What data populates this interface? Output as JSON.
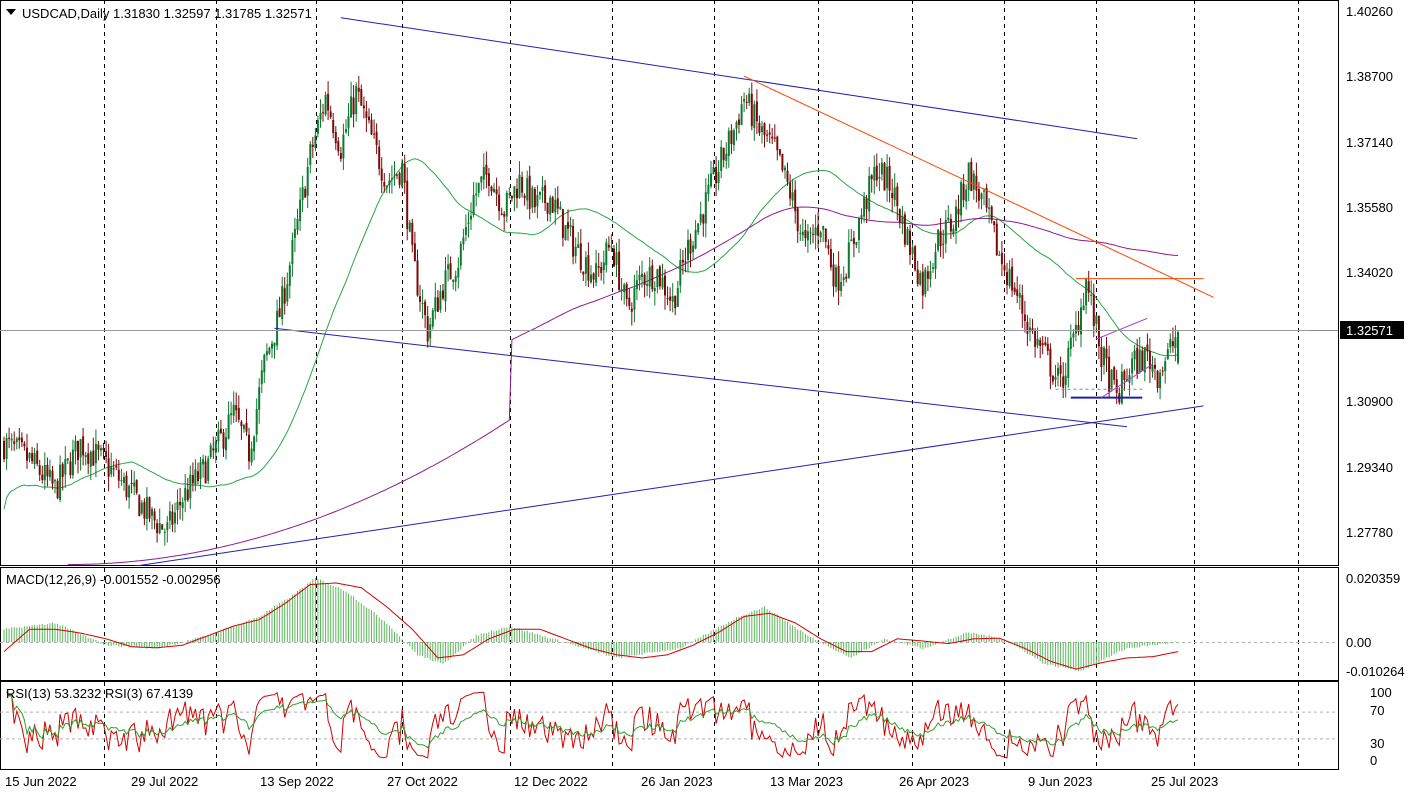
{
  "symbol_header": "USDCAD,Daily  1.31830 1.32597 1.31785 1.32571",
  "current_price_label": "1.32571",
  "colors": {
    "bull": "#0b7a2e",
    "bear": "#7a0a0a",
    "ma_fast": "#28a745",
    "ma_slow": "#8e1b8e",
    "trend_blue": "#1f1fb5",
    "trend_red": "#ff4500",
    "macd_hist": "#5cb85c",
    "macd_signal": "#d40000",
    "rsi13": "#2ca02c",
    "rsi3": "#d40000"
  },
  "chart_data": [
    {
      "type": "candlestick",
      "title": "USDCAD,Daily",
      "ohlc_last": {
        "open": 1.3183,
        "high": 1.32597,
        "low": 1.31785,
        "close": 1.32571
      },
      "y_ticks": [
        "1.40260",
        "1.38700",
        "1.37140",
        "1.35580",
        "1.34020",
        "1.32571",
        "1.30900",
        "1.29340",
        "1.27780"
      ],
      "ylim": [
        1.266,
        1.405
      ],
      "x_ticks": [
        "15 Jun 2022",
        "29 Jul 2022",
        "13 Sep 2022",
        "27 Oct 2022",
        "12 Dec 2022",
        "26 Jan 2023",
        "13 Mar 2023",
        "26 Apr 2023",
        "9 Jun 2023",
        "25 Jul 2023"
      ],
      "grid": true,
      "price_path": [
        [
          0,
          1.299
        ],
        [
          10,
          1.295
        ],
        [
          20,
          1.288
        ],
        [
          30,
          1.299
        ],
        [
          40,
          1.294
        ],
        [
          50,
          1.287
        ],
        [
          58,
          1.281
        ],
        [
          64,
          1.278
        ],
        [
          70,
          1.286
        ],
        [
          80,
          1.294
        ],
        [
          90,
          1.306
        ],
        [
          96,
          1.297
        ],
        [
          102,
          1.318
        ],
        [
          108,
          1.33
        ],
        [
          114,
          1.348
        ],
        [
          120,
          1.368
        ],
        [
          126,
          1.382
        ],
        [
          132,
          1.37
        ],
        [
          138,
          1.383
        ],
        [
          144,
          1.372
        ],
        [
          150,
          1.362
        ],
        [
          156,
          1.365
        ],
        [
          160,
          1.343
        ],
        [
          166,
          1.326
        ],
        [
          172,
          1.337
        ],
        [
          178,
          1.343
        ],
        [
          184,
          1.358
        ],
        [
          190,
          1.364
        ],
        [
          196,
          1.355
        ],
        [
          202,
          1.362
        ],
        [
          208,
          1.356
        ],
        [
          214,
          1.358
        ],
        [
          220,
          1.35
        ],
        [
          226,
          1.344
        ],
        [
          232,
          1.339
        ],
        [
          238,
          1.347
        ],
        [
          244,
          1.331
        ],
        [
          250,
          1.339
        ],
        [
          256,
          1.34
        ],
        [
          262,
          1.333
        ],
        [
          268,
          1.346
        ],
        [
          274,
          1.355
        ],
        [
          280,
          1.365
        ],
        [
          286,
          1.374
        ],
        [
          290,
          1.382
        ],
        [
          296,
          1.374
        ],
        [
          302,
          1.369
        ],
        [
          308,
          1.359
        ],
        [
          314,
          1.346
        ],
        [
          320,
          1.352
        ],
        [
          326,
          1.338
        ],
        [
          330,
          1.342
        ],
        [
          336,
          1.354
        ],
        [
          342,
          1.365
        ],
        [
          348,
          1.36
        ],
        [
          354,
          1.348
        ],
        [
          360,
          1.337
        ],
        [
          366,
          1.348
        ],
        [
          372,
          1.352
        ],
        [
          378,
          1.364
        ],
        [
          384,
          1.356
        ],
        [
          390,
          1.344
        ],
        [
          396,
          1.336
        ],
        [
          402,
          1.326
        ],
        [
          408,
          1.32
        ],
        [
          414,
          1.313
        ],
        [
          420,
          1.326
        ],
        [
          424,
          1.338
        ],
        [
          430,
          1.32
        ],
        [
          436,
          1.31
        ],
        [
          442,
          1.318
        ],
        [
          448,
          1.32
        ],
        [
          452,
          1.316
        ],
        [
          456,
          1.32
        ],
        [
          460,
          1.3257
        ]
      ]
    },
    {
      "type": "line",
      "title": "MACD(12,26,9) -0.001552 -0.002956",
      "y_ticks": [
        "0.020359",
        "0.00",
        "-0.010264"
      ],
      "ylim": [
        -0.0125,
        0.0225
      ],
      "signal_path": [
        [
          0,
          -0.003
        ],
        [
          10,
          0.004
        ],
        [
          20,
          0.004
        ],
        [
          30,
          0.0028
        ],
        [
          40,
          0.001
        ],
        [
          50,
          -0.0015
        ],
        [
          60,
          -0.0018
        ],
        [
          70,
          -0.001
        ],
        [
          80,
          0.002
        ],
        [
          90,
          0.005
        ],
        [
          100,
          0.007
        ],
        [
          110,
          0.012
        ],
        [
          120,
          0.018
        ],
        [
          130,
          0.0185
        ],
        [
          140,
          0.017
        ],
        [
          150,
          0.011
        ],
        [
          160,
          0.004
        ],
        [
          170,
          -0.005
        ],
        [
          180,
          -0.004
        ],
        [
          190,
          0.001
        ],
        [
          200,
          0.004
        ],
        [
          210,
          0.004
        ],
        [
          220,
          0.001
        ],
        [
          230,
          -0.002
        ],
        [
          240,
          -0.004
        ],
        [
          250,
          -0.005
        ],
        [
          260,
          -0.004
        ],
        [
          270,
          -0.001
        ],
        [
          280,
          0.003
        ],
        [
          290,
          0.008
        ],
        [
          300,
          0.009
        ],
        [
          310,
          0.006
        ],
        [
          320,
          0.001
        ],
        [
          330,
          -0.003
        ],
        [
          340,
          -0.003
        ],
        [
          350,
          0.001
        ],
        [
          360,
          0.0003
        ],
        [
          370,
          -0.0005
        ],
        [
          380,
          0.001
        ],
        [
          390,
          0.0012
        ],
        [
          400,
          -0.002
        ],
        [
          410,
          -0.006
        ],
        [
          420,
          -0.0085
        ],
        [
          430,
          -0.0065
        ],
        [
          440,
          -0.005
        ],
        [
          450,
          -0.0046
        ],
        [
          460,
          -0.003
        ]
      ],
      "hist_path": [
        [
          0,
          0.004
        ],
        [
          20,
          0.006
        ],
        [
          40,
          -0.001
        ],
        [
          60,
          -0.002
        ],
        [
          80,
          0.002
        ],
        [
          100,
          0.008
        ],
        [
          112,
          0.014
        ],
        [
          122,
          0.02
        ],
        [
          134,
          0.016
        ],
        [
          150,
          0.006
        ],
        [
          162,
          -0.004
        ],
        [
          172,
          -0.007
        ],
        [
          185,
          0.002
        ],
        [
          198,
          0.005
        ],
        [
          215,
          0.001
        ],
        [
          240,
          -0.005
        ],
        [
          265,
          -0.002
        ],
        [
          288,
          0.008
        ],
        [
          298,
          0.011
        ],
        [
          315,
          0.002
        ],
        [
          332,
          -0.005
        ],
        [
          345,
          0.001
        ],
        [
          360,
          -0.002
        ],
        [
          378,
          0.003
        ],
        [
          392,
          0.001
        ],
        [
          408,
          -0.007
        ],
        [
          422,
          -0.009
        ],
        [
          440,
          -0.002
        ],
        [
          460,
          0.0
        ]
      ]
    },
    {
      "type": "line",
      "title": "RSI(13) 53.3232  RSI(3) 67.4139",
      "y_ticks": [
        "100",
        "70",
        "30",
        "0"
      ],
      "ylim": [
        0,
        100
      ],
      "levels": [
        70,
        30
      ],
      "series": [
        {
          "name": "RSI(13)",
          "last": 53.3232
        },
        {
          "name": "RSI(3)",
          "last": 67.4139
        }
      ]
    }
  ]
}
